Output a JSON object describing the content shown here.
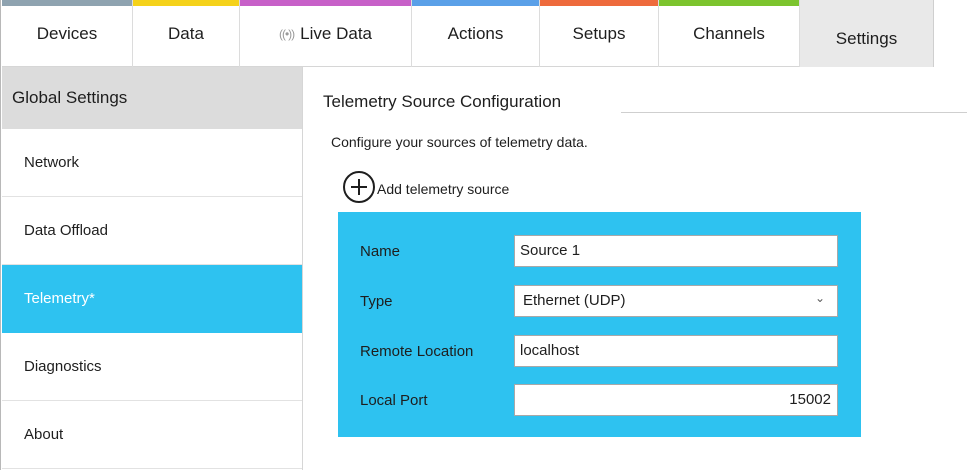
{
  "tabs": [
    {
      "label": "Devices",
      "color": "#8fa3b0"
    },
    {
      "label": "Data",
      "color": "#f5d21a"
    },
    {
      "label": "Live Data",
      "color": "#c760c8",
      "icon": "broadcast-icon"
    },
    {
      "label": "Actions",
      "color": "#5aa0e8"
    },
    {
      "label": "Setups",
      "color": "#ee6a3c"
    },
    {
      "label": "Channels",
      "color": "#7cc42e"
    },
    {
      "label": "Settings",
      "color": "",
      "active": true
    }
  ],
  "live_icon_glyph": "((•))",
  "sidebar": {
    "header": "Global Settings",
    "items": [
      {
        "label": "Network"
      },
      {
        "label": "Data Offload"
      },
      {
        "label": "Telemetry*",
        "active": true
      },
      {
        "label": "Diagnostics"
      },
      {
        "label": "About"
      }
    ]
  },
  "main": {
    "section_title": "Telemetry Source Configuration",
    "description": "Configure your sources of telemetry data.",
    "add_button_label": "Add telemetry source",
    "source": {
      "name_label": "Name",
      "name_value": "Source 1",
      "type_label": "Type",
      "type_value": "Ethernet (UDP)",
      "remote_label": "Remote Location",
      "remote_value": "localhost",
      "port_label": "Local Port",
      "port_value": "15002"
    }
  },
  "colors": {
    "accent": "#2ec2f0",
    "sidebar_header_bg": "#dcdcdc",
    "active_tab_bg": "#e9e9e9"
  }
}
